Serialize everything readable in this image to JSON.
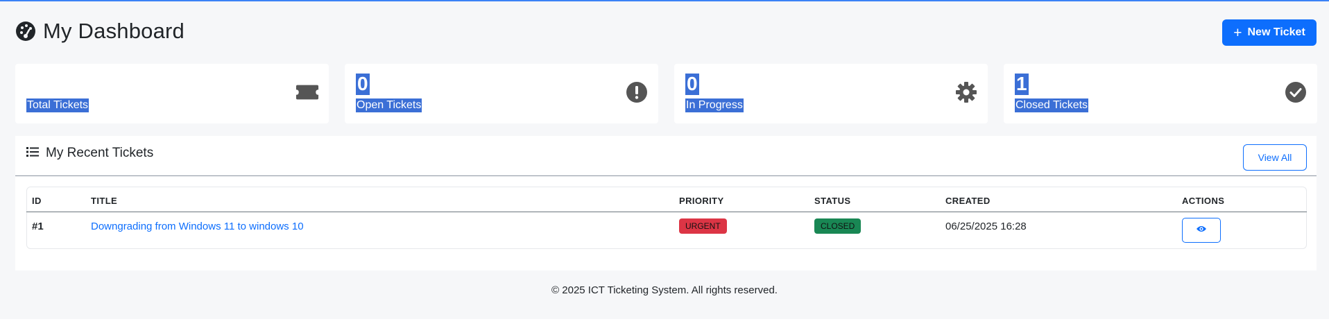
{
  "header": {
    "title": "My Dashboard",
    "new_ticket_label": "New Ticket"
  },
  "stats": [
    {
      "value": "",
      "label": "Total Tickets",
      "icon": "ticket-icon"
    },
    {
      "value": "0",
      "label": "Open Tickets",
      "icon": "exclamation-circle-icon"
    },
    {
      "value": "0",
      "label": "In Progress",
      "icon": "gear-icon"
    },
    {
      "value": "1",
      "label": "Closed Tickets",
      "icon": "check-circle-icon"
    }
  ],
  "recent": {
    "title": "My Recent Tickets",
    "view_all_label": "View All",
    "columns": [
      "ID",
      "TITLE",
      "PRIORITY",
      "STATUS",
      "CREATED",
      "ACTIONS"
    ],
    "rows": [
      {
        "id": "#1",
        "title": "Downgrading from Windows 11 to windows 10",
        "priority": "URGENT",
        "status": "CLOSED",
        "created": "06/25/2025 16:28",
        "action_icon": "eye-icon"
      }
    ]
  },
  "footer": {
    "text": "© 2025 ICT Ticketing System. All rights reserved."
  },
  "colors": {
    "primary": "#0d6efd",
    "urgent": "#dc3545",
    "closed": "#198754",
    "selection": "#3b6fd6",
    "icon_gray": "#555555"
  }
}
